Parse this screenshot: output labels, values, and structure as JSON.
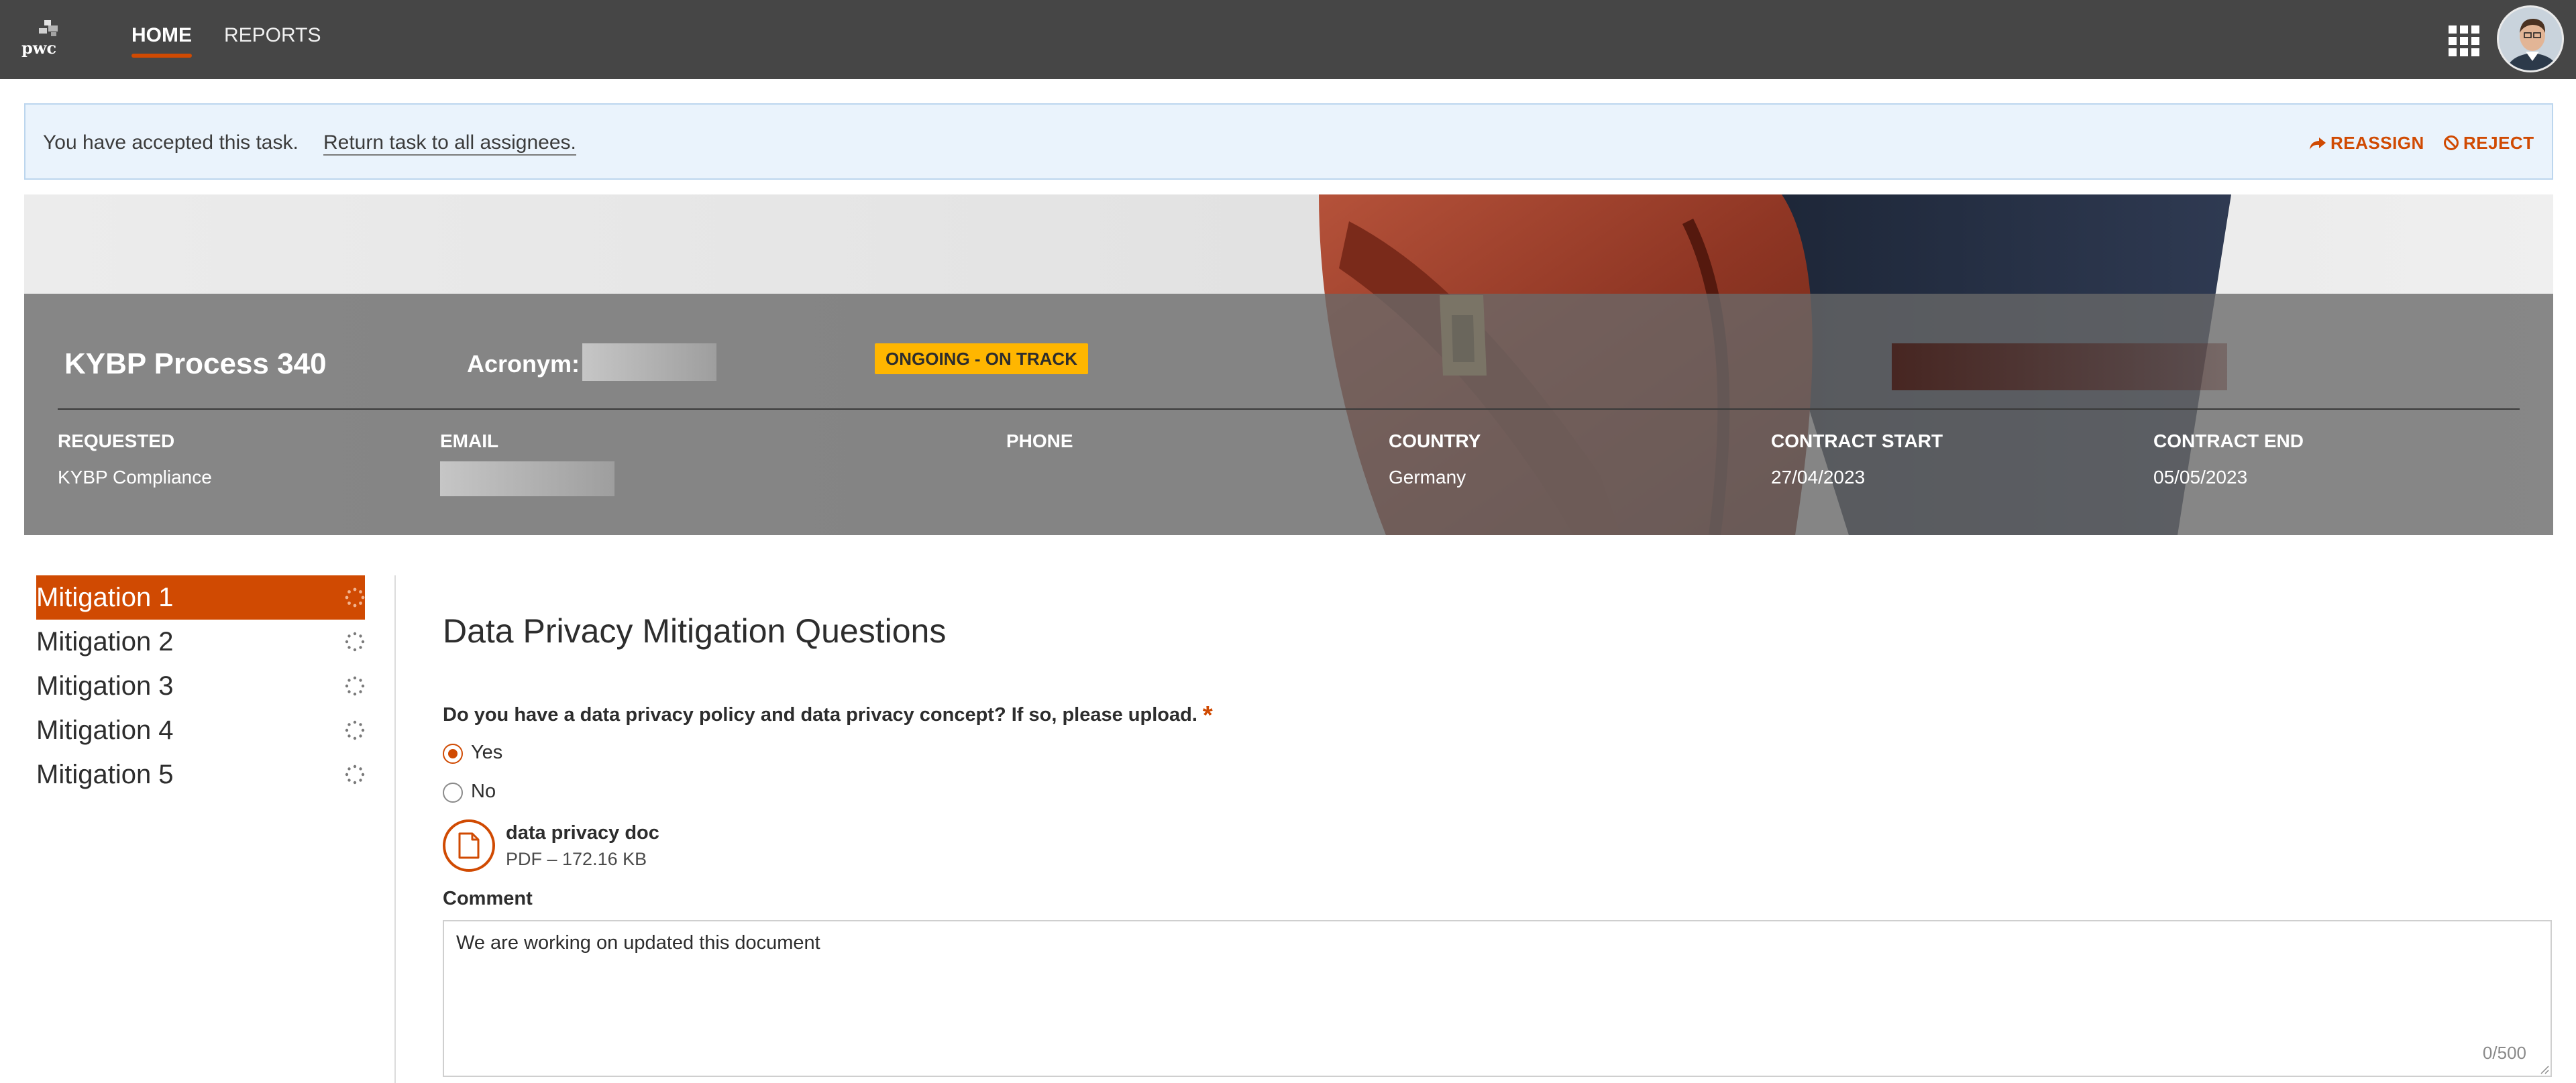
{
  "header": {
    "logo_text": "pwc",
    "nav": [
      {
        "label": "HOME",
        "active": true
      },
      {
        "label": "REPORTS",
        "active": false
      }
    ],
    "apps_icon": "grid-icon",
    "avatar_icon": "user-avatar"
  },
  "notice": {
    "text": "You have accepted this task.",
    "link": "Return task to all assignees.",
    "actions": [
      {
        "label": "REASSIGN",
        "icon": "share-icon"
      },
      {
        "label": "REJECT",
        "icon": "block-icon"
      }
    ]
  },
  "hero": {
    "title": "KYBP Process 340",
    "acronym_label": "Acronym:",
    "status": "ONGOING - ON TRACK",
    "fields": [
      {
        "label": "REQUESTED",
        "value": "KYBP Compliance"
      },
      {
        "label": "EMAIL",
        "value": ""
      },
      {
        "label": "PHONE",
        "value": ""
      },
      {
        "label": "COUNTRY",
        "value": "Germany"
      },
      {
        "label": "CONTRACT START",
        "value": "27/04/2023"
      },
      {
        "label": "CONTRACT END",
        "value": "05/05/2023"
      }
    ]
  },
  "sidebar": {
    "items": [
      {
        "label": "Mitigation 1",
        "active": true,
        "status_icon": "loading-spinner-icon"
      },
      {
        "label": "Mitigation 2",
        "active": false,
        "status_icon": "loading-spinner-icon"
      },
      {
        "label": "Mitigation 3",
        "active": false,
        "status_icon": "loading-spinner-icon"
      },
      {
        "label": "Mitigation 4",
        "active": false,
        "status_icon": "loading-spinner-icon"
      },
      {
        "label": "Mitigation 5",
        "active": false,
        "status_icon": "loading-spinner-icon"
      }
    ]
  },
  "form": {
    "title": "Data Privacy Mitigation Questions",
    "question": "Do you have a data privacy policy and data privacy concept? If so, please upload.",
    "required_marker": "*",
    "options": [
      {
        "label": "Yes",
        "selected": true
      },
      {
        "label": "No",
        "selected": false
      }
    ],
    "attachment": {
      "name": "data privacy doc",
      "meta": "PDF – 172.16 KB",
      "icon": "document-icon"
    },
    "comment_label": "Comment",
    "comment_value": "We are working on updated this document",
    "comment_counter": "0/500"
  },
  "colors": {
    "accent": "#d04a02",
    "topbar": "#464646",
    "status_badge": "#ffb600",
    "notice_bg": "#eaf3fc"
  }
}
